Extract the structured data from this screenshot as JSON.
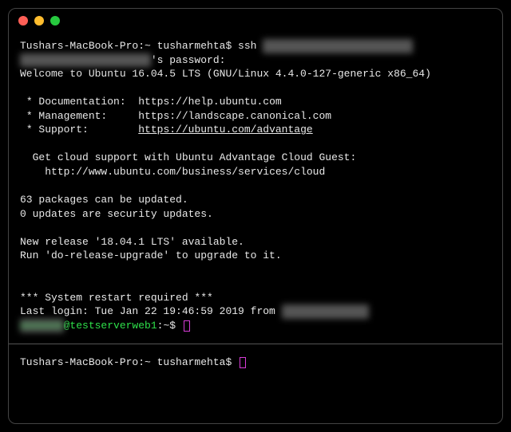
{
  "top_pane": {
    "prompt1_host": "Tushars-MacBook-Pro:~ tusharmehta$ ",
    "prompt1_cmd": "ssh ",
    "password_label": "'s password:",
    "welcome": "Welcome to Ubuntu 16.04.5 LTS (GNU/Linux 4.4.0-127-generic x86_64)",
    "doc_label": " * Documentation:  ",
    "doc_url": "https://help.ubuntu.com",
    "mgmt_label": " * Management:     ",
    "mgmt_url": "https://landscape.canonical.com",
    "support_label": " * Support:        ",
    "support_url": "https://ubuntu.com/advantage",
    "cloud1": "  Get cloud support with Ubuntu Advantage Cloud Guest:",
    "cloud2": "    http://www.ubuntu.com/business/services/cloud",
    "pkg1": "63 packages can be updated.",
    "pkg2": "0 updates are security updates.",
    "release1": "New release '18.04.1 LTS' available.",
    "release2": "Run 'do-release-upgrade' to upgrade to it.",
    "restart": "*** System restart required ***",
    "last_login_prefix": "Last login: Tue Jan 22 19:46:59 2019 from ",
    "remote_prompt_host": "@testserverweb1",
    "remote_prompt_suffix": ":~$ "
  },
  "bottom_pane": {
    "prompt": "Tushars-MacBook-Pro:~ tusharmehta$ "
  }
}
